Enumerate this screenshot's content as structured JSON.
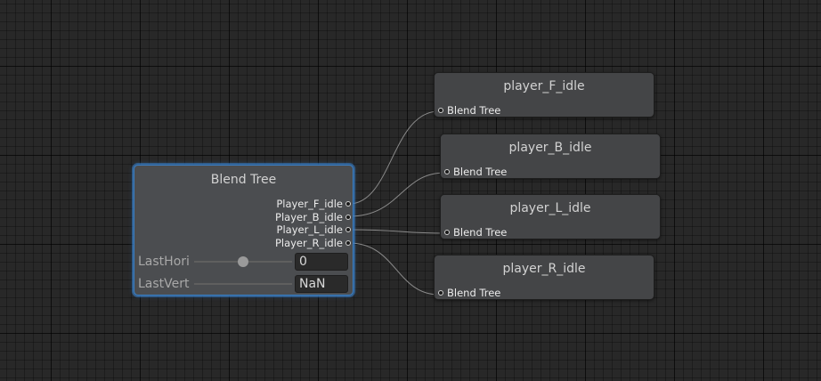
{
  "blend_tree": {
    "title": "Blend Tree",
    "outputs": [
      {
        "label": "Player_F_idle"
      },
      {
        "label": "Player_B_idle"
      },
      {
        "label": "Player_L_idle"
      },
      {
        "label": "Player_R_idle"
      }
    ],
    "params": [
      {
        "label": "LastHori",
        "value": "0",
        "slider_fraction": 0.5
      },
      {
        "label": "LastVert",
        "value": "NaN",
        "slider_fraction": null
      }
    ]
  },
  "motion_nodes": [
    {
      "title": "player_F_idle",
      "port_label": "Blend Tree"
    },
    {
      "title": "player_B_idle",
      "port_label": "Blend Tree"
    },
    {
      "title": "player_L_idle",
      "port_label": "Blend Tree"
    },
    {
      "title": "player_R_idle",
      "port_label": "Blend Tree"
    }
  ],
  "colors": {
    "canvas": "#282828",
    "node": "#444547",
    "selected_outline": "#3b7fc4",
    "wire": "#8a8a8a"
  }
}
